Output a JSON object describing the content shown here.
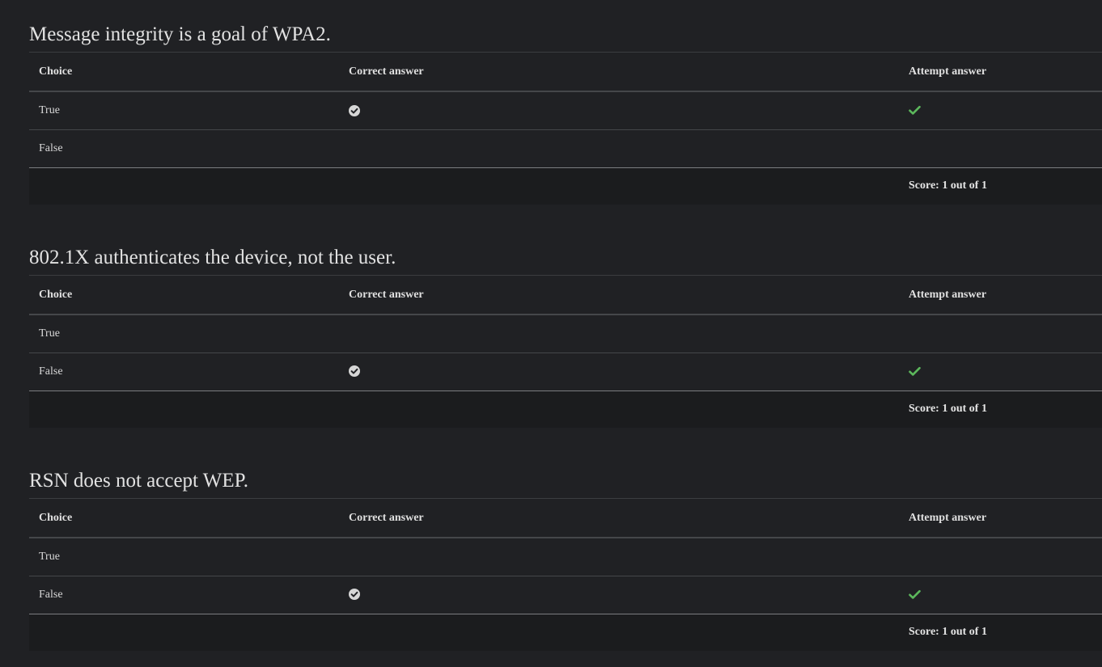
{
  "columns": {
    "choice": "Choice",
    "correct": "Correct answer",
    "attempt": "Attempt answer"
  },
  "colors": {
    "background": "#202124",
    "footer_background": "#1b1c1e",
    "correct_icon": "#d6d6d6",
    "attempt_check": "#5cb85c"
  },
  "questions": [
    {
      "title": "Message integrity is a goal of WPA2.",
      "rows": [
        {
          "choice": "True",
          "correct": true,
          "attempt": true
        },
        {
          "choice": "False",
          "correct": false,
          "attempt": false
        }
      ],
      "score": "Score: 1 out of 1"
    },
    {
      "title": "802.1X authenticates the device, not the user.",
      "rows": [
        {
          "choice": "True",
          "correct": false,
          "attempt": false
        },
        {
          "choice": "False",
          "correct": true,
          "attempt": true
        }
      ],
      "score": "Score: 1 out of 1"
    },
    {
      "title": "RSN does not accept WEP.",
      "rows": [
        {
          "choice": "True",
          "correct": false,
          "attempt": false
        },
        {
          "choice": "False",
          "correct": true,
          "attempt": true
        }
      ],
      "score": "Score: 1 out of 1"
    }
  ],
  "icons": {
    "correct": "circle-check-icon",
    "attempt": "check-icon"
  }
}
